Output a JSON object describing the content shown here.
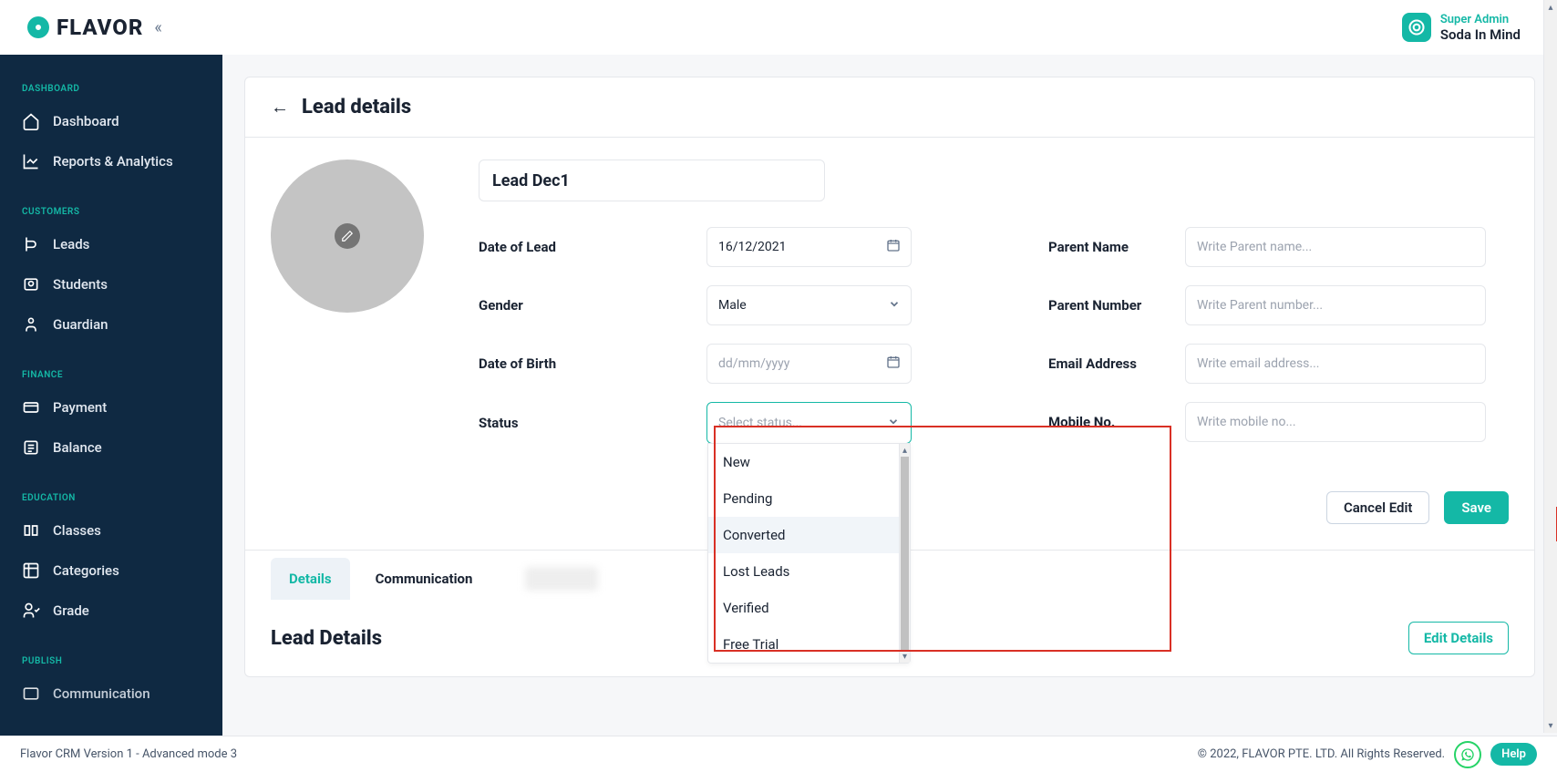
{
  "brand": {
    "name": "FLAVOR"
  },
  "user": {
    "role": "Super Admin",
    "name": "Soda In Mind"
  },
  "sidebar": {
    "sections": [
      {
        "label": "Dashboard",
        "items": [
          {
            "label": "Dashboard",
            "icon": "home"
          },
          {
            "label": "Reports & Analytics",
            "icon": "chart"
          }
        ]
      },
      {
        "label": "Customers",
        "items": [
          {
            "label": "Leads",
            "icon": "leads"
          },
          {
            "label": "Students",
            "icon": "students"
          },
          {
            "label": "Guardian",
            "icon": "guardian"
          }
        ]
      },
      {
        "label": "Finance",
        "items": [
          {
            "label": "Payment",
            "icon": "payment"
          },
          {
            "label": "Balance",
            "icon": "balance"
          }
        ]
      },
      {
        "label": "Education",
        "items": [
          {
            "label": "Classes",
            "icon": "classes"
          },
          {
            "label": "Categories",
            "icon": "categories"
          },
          {
            "label": "Grade",
            "icon": "grade"
          }
        ]
      },
      {
        "label": "Publish",
        "items": [
          {
            "label": "Communication",
            "icon": "communication"
          }
        ]
      }
    ]
  },
  "page": {
    "title": "Lead details",
    "lead_name": "Lead Dec1",
    "fields": {
      "date_of_lead_label": "Date of Lead",
      "date_of_lead_value": "16/12/2021",
      "gender_label": "Gender",
      "gender_value": "Male",
      "dob_label": "Date of Birth",
      "dob_placeholder": "dd/mm/yyyy",
      "status_label": "Status",
      "status_placeholder": "Select status...",
      "parent_name_label": "Parent Name",
      "parent_name_placeholder": "Write Parent name...",
      "parent_number_label": "Parent Number",
      "parent_number_placeholder": "Write Parent number...",
      "email_label": "Email Address",
      "email_placeholder": "Write email address...",
      "mobile_label": "Mobile No.",
      "mobile_placeholder": "Write mobile no..."
    },
    "status_options": [
      "New",
      "Pending",
      "Converted",
      "Lost Leads",
      "Verified",
      "Free Trial"
    ],
    "status_highlighted_index": 2,
    "actions": {
      "cancel": "Cancel Edit",
      "save": "Save"
    },
    "tabs": {
      "details": "Details",
      "communication": "Communication"
    },
    "details_section": {
      "title": "Lead Details",
      "edit": "Edit Details"
    }
  },
  "footer": {
    "left": "Flavor CRM Version 1 - Advanced mode 3",
    "right": "© 2022, FLAVOR PTE. LTD. All Rights Reserved.",
    "help": "Help"
  }
}
